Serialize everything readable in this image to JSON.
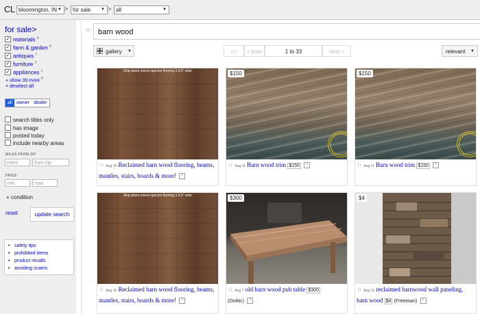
{
  "header": {
    "logo": "CL",
    "location": "bloomington, IN",
    "section": "for sale",
    "category": "all",
    "separator": ">"
  },
  "sidebar": {
    "title": "for sale>",
    "categories": [
      {
        "label": "materials",
        "count": "8",
        "checked": true
      },
      {
        "label": "farm & garden",
        "count": "8",
        "checked": true
      },
      {
        "label": "antiques",
        "count": "7",
        "checked": true
      },
      {
        "label": "furniture",
        "count": "2",
        "checked": true
      },
      {
        "label": "appliances",
        "count": "1",
        "checked": true
      }
    ],
    "show_more": "+ show 39 more",
    "show_more_count": "8",
    "deselect_all": "× deselect all",
    "seller_tabs": [
      "all",
      "owner",
      "dealer"
    ],
    "options": [
      "search titles only",
      "has image",
      "posted today",
      "include nearby areas"
    ],
    "miles_label": "MILES FROM ZIP",
    "miles_placeholder": "miles",
    "zip_placeholder": "from zip",
    "price_label": "PRICE",
    "min_placeholder": "min",
    "max_placeholder": "max",
    "condition": "+ condition",
    "reset": "reset",
    "update": "update search",
    "tips": [
      "safety tips",
      "prohibited items",
      "product recalls",
      "avoiding scams"
    ]
  },
  "search": {
    "query": "barn wood",
    "view": "gallery",
    "first": "<<",
    "prev": "< prev",
    "range": "1 to 33",
    "next": "next >",
    "sort": "relevant"
  },
  "listings": [
    {
      "price": "",
      "watermark": "Skip plane mixed species flooring 3,4,5\" wide",
      "date": "Aug 16",
      "title": "Reclaimed barn wood flooring, beams, mantles, stairs, boards & more!",
      "tag_price": "",
      "location": ""
    },
    {
      "price": "$150",
      "watermark": "",
      "date": "Aug 11",
      "title": "Barn wood trim",
      "tag_price": "$150",
      "location": ""
    },
    {
      "price": "$150",
      "watermark": "",
      "date": "Aug 11",
      "title": "Barn wood trim",
      "tag_price": "$150",
      "location": ""
    },
    {
      "price": "",
      "watermark": "Skip plane mixed species flooring 3,4,5\" wide",
      "date": "Aug 16",
      "title": "Reclaimed barn wood flooring, beams, mantles, stairs, boards & more!",
      "tag_price": "",
      "location": ""
    },
    {
      "price": "$300",
      "watermark": "",
      "date": "Aug 7",
      "title": "old barn wood pub table",
      "tag_price": "$300",
      "location": "(Oolitic)"
    },
    {
      "price": "$4",
      "watermark": "",
      "date": "Aug 13",
      "title": "reclaimed barnwood wall paneling, barn wood",
      "tag_price": "$4",
      "location": "(Freetown)"
    }
  ],
  "colors": {
    "link": "#0000cc",
    "active_tab": "#1e5bd8",
    "sidebar_bg": "#eeeeee"
  }
}
